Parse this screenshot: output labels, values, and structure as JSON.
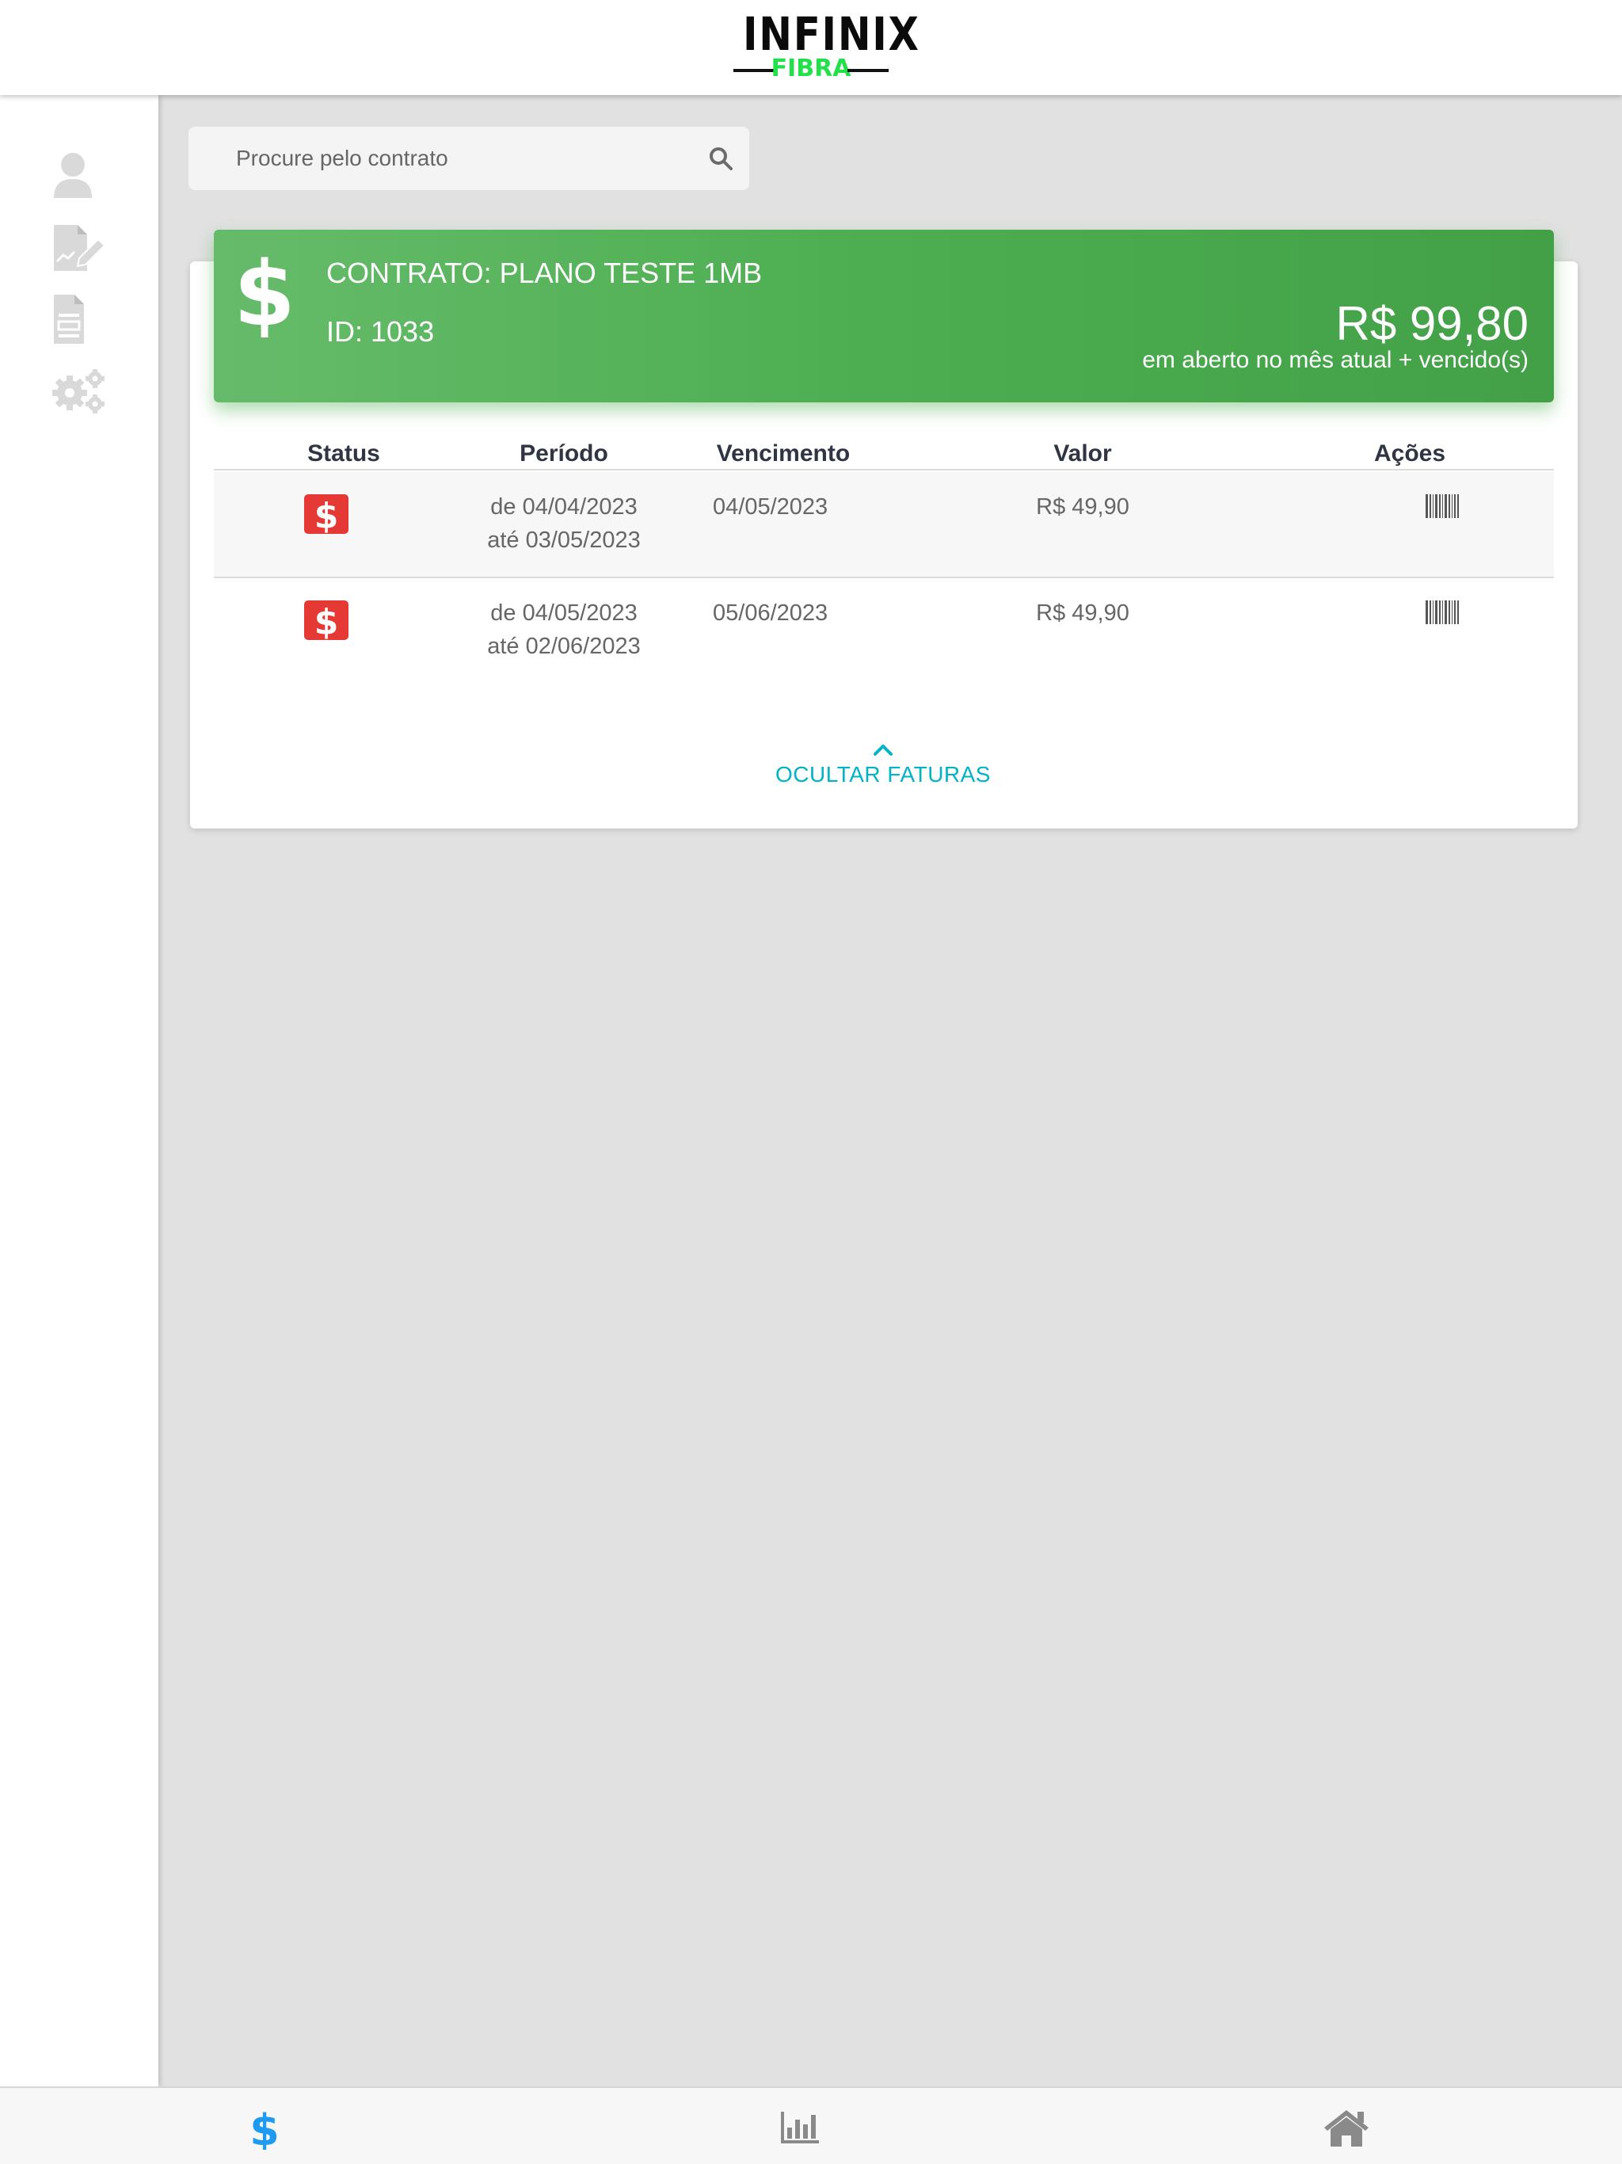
{
  "header": {
    "logo_main": "INFINIX",
    "logo_sub": "FIBRA"
  },
  "sidebar": {
    "items": [
      {
        "icon": "user-icon"
      },
      {
        "icon": "contract-edit-icon"
      },
      {
        "icon": "document-icon"
      },
      {
        "icon": "settings-gears-icon"
      }
    ]
  },
  "search": {
    "placeholder": "Procure pelo contrato",
    "value": ""
  },
  "contract": {
    "title": "CONTRATO: PLANO TESTE 1MB",
    "id": "ID: 1033",
    "amount": "R$ 99,80",
    "amount_note": "em aberto no mês atual + vencido(s)",
    "color": "#4caf50"
  },
  "table": {
    "headers": [
      "Status",
      "Período",
      "Vencimento",
      "Valor",
      "Ações"
    ],
    "rows": [
      {
        "period_from": "de 04/04/2023",
        "period_to": "até 03/05/2023",
        "due": "04/05/2023",
        "value": "R$ 49,90",
        "status": "open"
      },
      {
        "period_from": "de 04/05/2023",
        "period_to": "até 02/06/2023",
        "due": "05/06/2023",
        "value": "R$ 49,90",
        "status": "open"
      }
    ],
    "status_color": "#e53935"
  },
  "toggle": {
    "label": "OCULTAR FATURAS",
    "color": "#00b3c8"
  },
  "bottom_nav": {
    "items": [
      {
        "icon": "dollar-icon",
        "active": true
      },
      {
        "icon": "bar-chart-icon",
        "active": false
      },
      {
        "icon": "home-icon",
        "active": false
      }
    ],
    "active_color": "#1e9bf0"
  }
}
